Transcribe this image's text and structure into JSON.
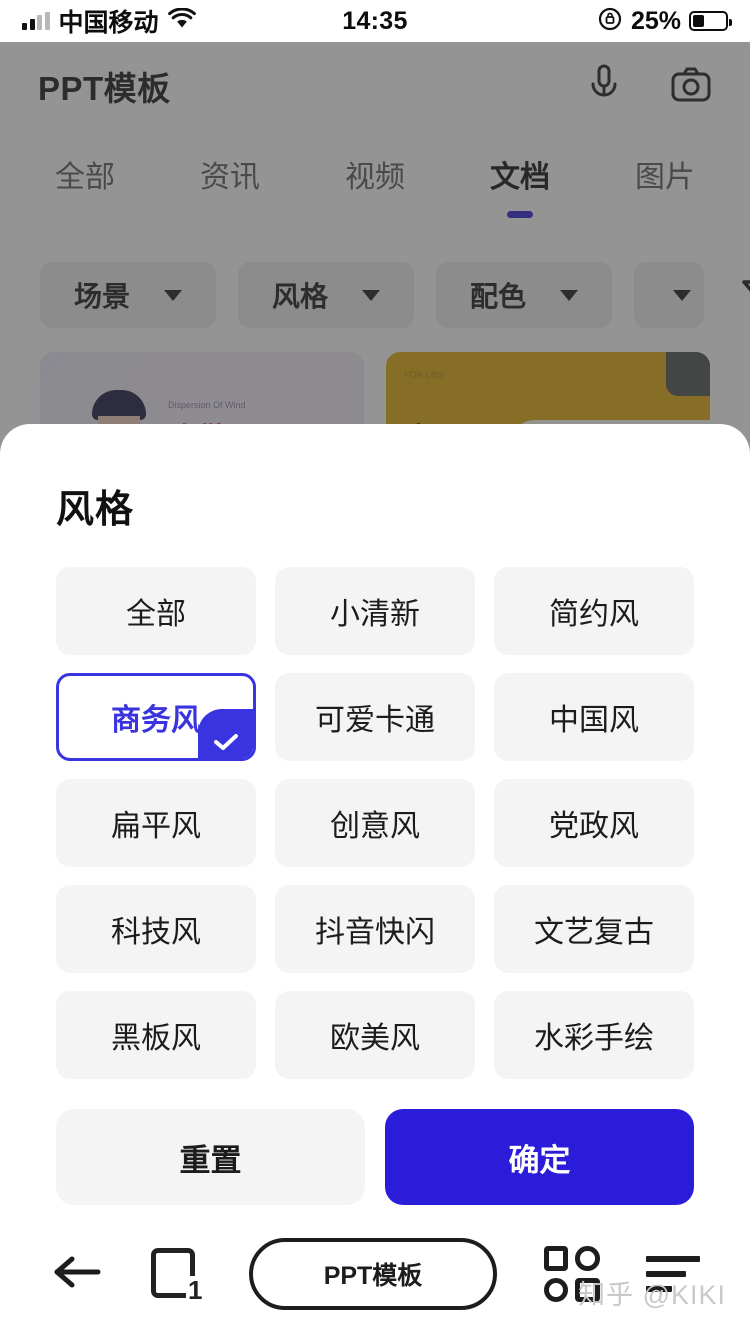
{
  "status_bar": {
    "carrier": "中国移动",
    "time": "14:35",
    "battery_percent": "25%",
    "signal_icon": "signal-bars-icon",
    "wifi_icon": "wifi-icon",
    "rotation_lock_icon": "rotation-lock-icon",
    "battery_icon": "battery-icon"
  },
  "app_header": {
    "title": "PPT模板",
    "mic_icon": "microphone-icon",
    "camera_icon": "camera-icon"
  },
  "tabs": [
    {
      "label": "全部",
      "active": false
    },
    {
      "label": "资讯",
      "active": false
    },
    {
      "label": "视频",
      "active": false
    },
    {
      "label": "文档",
      "active": true
    },
    {
      "label": "图片",
      "active": false
    }
  ],
  "filters": {
    "chips": [
      {
        "label": "场景",
        "caret_icon": "chevron-down-icon"
      },
      {
        "label": "风格",
        "caret_icon": "chevron-down-icon"
      },
      {
        "label": "配色",
        "caret_icon": "chevron-down-icon"
      }
    ],
    "funnel_icon": "filter-funnel-icon"
  },
  "result_cards": [
    {
      "eyebrow": "Dispersion Of Wind",
      "title": "弥散风"
    },
    {
      "eyebrow": "FOR UBS",
      "title": "启亚风"
    }
  ],
  "sheet": {
    "title": "风格",
    "options": [
      {
        "label": "全部",
        "selected": false
      },
      {
        "label": "小清新",
        "selected": false
      },
      {
        "label": "简约风",
        "selected": false
      },
      {
        "label": "商务风",
        "selected": true
      },
      {
        "label": "可爱卡通",
        "selected": false
      },
      {
        "label": "中国风",
        "selected": false
      },
      {
        "label": "扁平风",
        "selected": false
      },
      {
        "label": "创意风",
        "selected": false
      },
      {
        "label": "党政风",
        "selected": false
      },
      {
        "label": "科技风",
        "selected": false
      },
      {
        "label": "抖音快闪",
        "selected": false
      },
      {
        "label": "文艺复古",
        "selected": false
      },
      {
        "label": "黑板风",
        "selected": false
      },
      {
        "label": "欧美风",
        "selected": false
      },
      {
        "label": "水彩手绘",
        "selected": false
      }
    ],
    "reset_label": "重置",
    "confirm_label": "确定",
    "check_icon": "check-icon"
  },
  "bottom_bar": {
    "back_icon": "back-arrow-icon",
    "tab_count": "1",
    "tab_count_icon": "tab-count-icon",
    "url_label": "PPT模板",
    "apps_icon": "grid-apps-icon",
    "menu_icon": "menu-lines-icon"
  },
  "watermark": "知乎 @KIKI",
  "colors": {
    "accent_blue": "#2a1cd8",
    "selected_border": "#3a34e0",
    "chip_gray": "#f4f4f5",
    "scrim": "rgba(60,60,60,0.55)"
  }
}
